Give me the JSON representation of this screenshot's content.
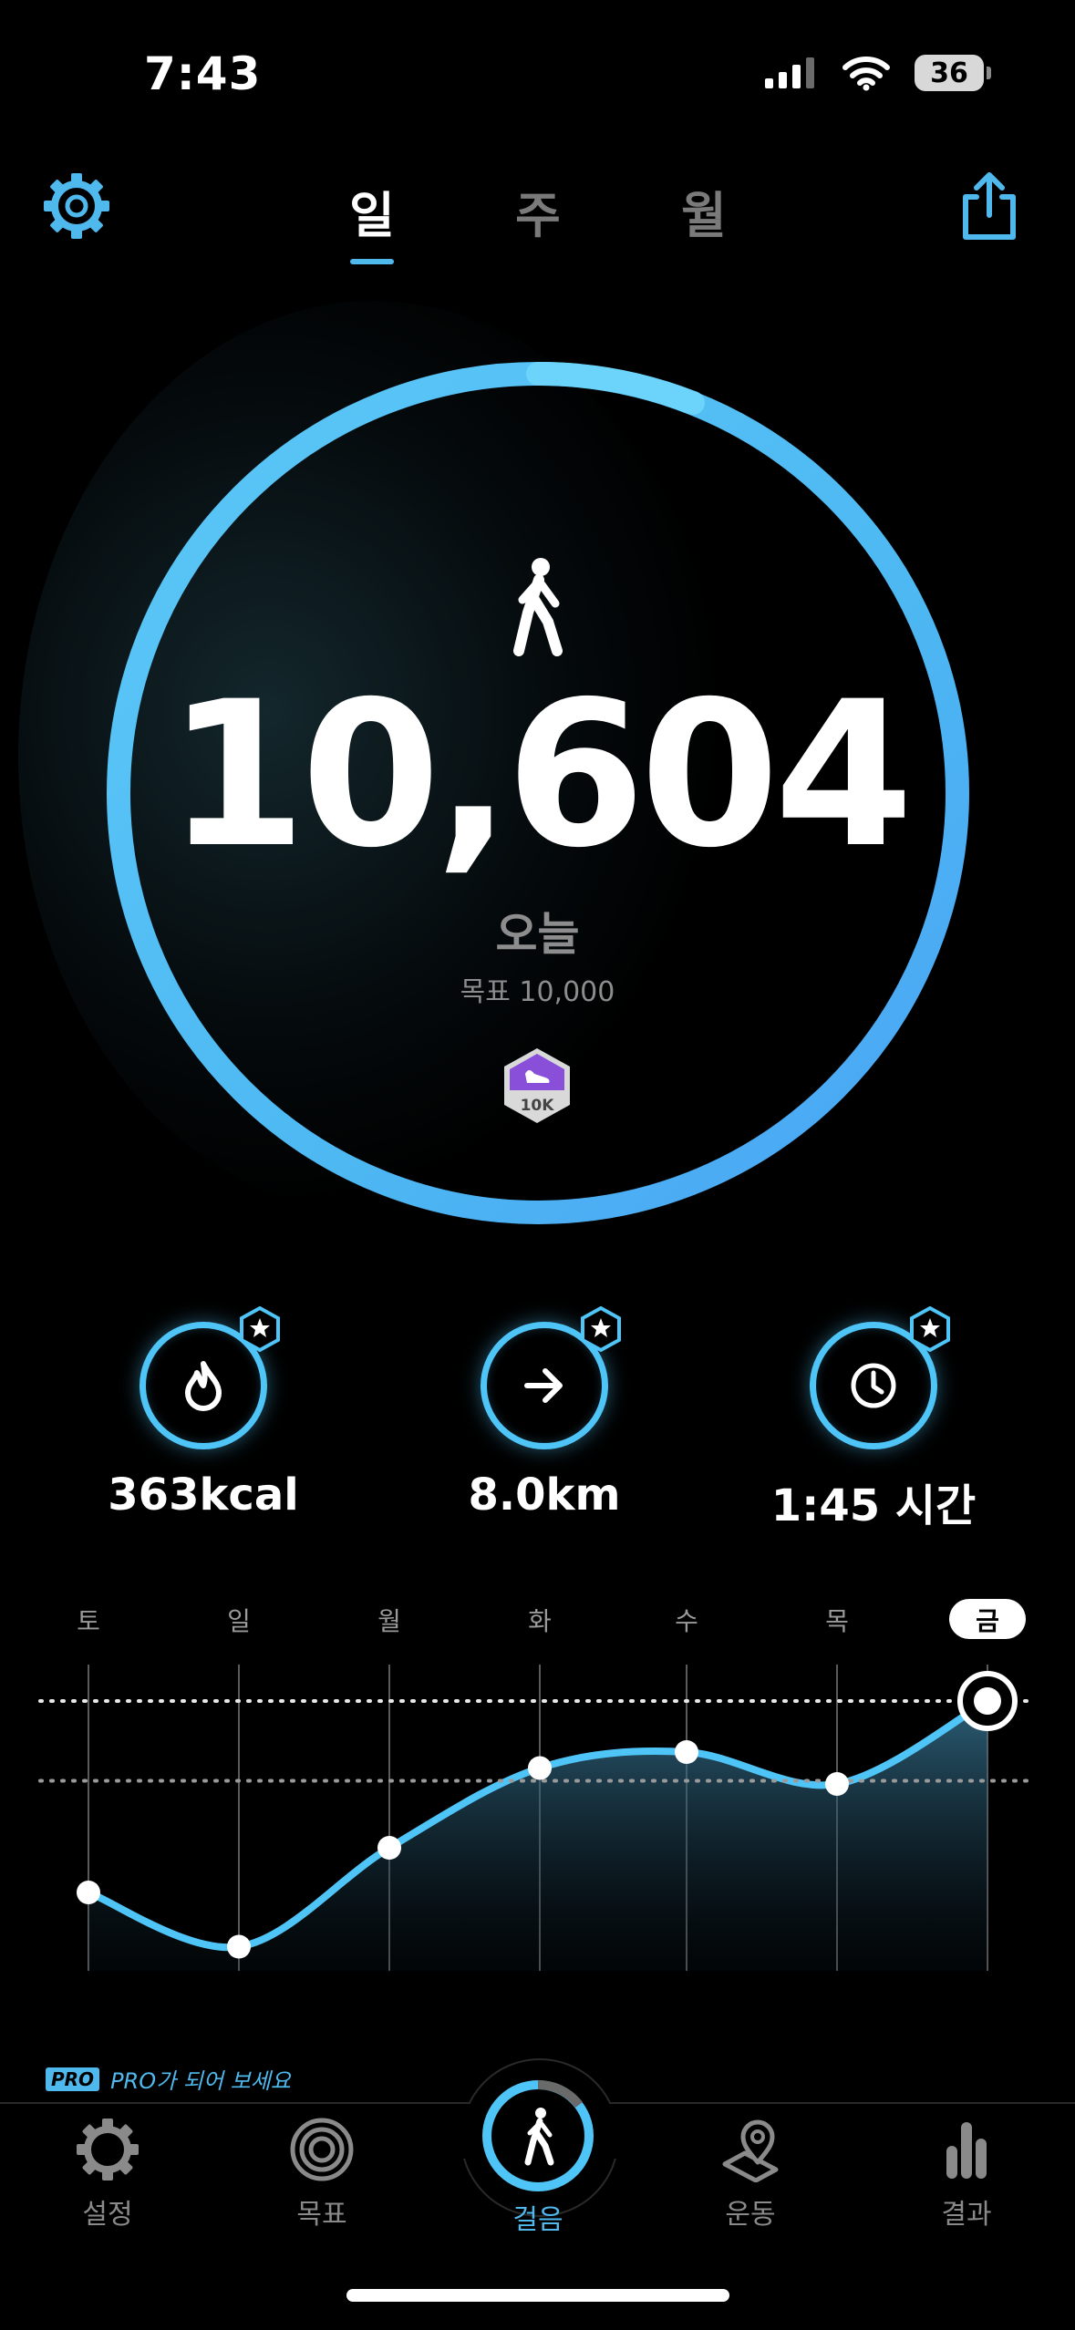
{
  "status_bar": {
    "time": "7:43",
    "battery": "36"
  },
  "header": {
    "tabs": [
      {
        "label": "일",
        "active": true
      },
      {
        "label": "주",
        "active": false
      },
      {
        "label": "월",
        "active": false
      }
    ]
  },
  "summary": {
    "steps": "10,604",
    "period_label": "오늘",
    "goal_text": "목표 10,000",
    "badge_text": "10K",
    "progress_fraction": 1.06
  },
  "stats": [
    {
      "value": "363kcal",
      "icon": "flame-icon"
    },
    {
      "value": "8.0km",
      "icon": "arrow-right-icon"
    },
    {
      "value": "1:45 시간",
      "icon": "clock-icon"
    }
  ],
  "chart_data": {
    "type": "line",
    "categories": [
      "토",
      "일",
      "월",
      "화",
      "수",
      "목",
      "금"
    ],
    "selected_category": "금",
    "relative_values": [
      0.24,
      0.07,
      0.38,
      0.63,
      0.68,
      0.58,
      0.84
    ],
    "reference_lines": [
      0.84,
      0.59
    ],
    "line_color": "#4fc4f7",
    "area_fill": true
  },
  "promo": {
    "badge": "PRO",
    "text": "PRO가 되어 보세요"
  },
  "nav": {
    "items": [
      {
        "label": "설정",
        "icon": "gear-icon",
        "active": false
      },
      {
        "label": "목표",
        "icon": "target-icon",
        "active": false
      },
      {
        "label": "걸음",
        "icon": "walker-icon",
        "active": true
      },
      {
        "label": "운동",
        "icon": "map-pin-icon",
        "active": false
      },
      {
        "label": "결과",
        "icon": "bar-chart-icon",
        "active": false
      }
    ]
  },
  "colors": {
    "accent": "#4fc4f7",
    "ring_end": "#4aa3f5",
    "badge_purple": "#8a4fd8"
  }
}
